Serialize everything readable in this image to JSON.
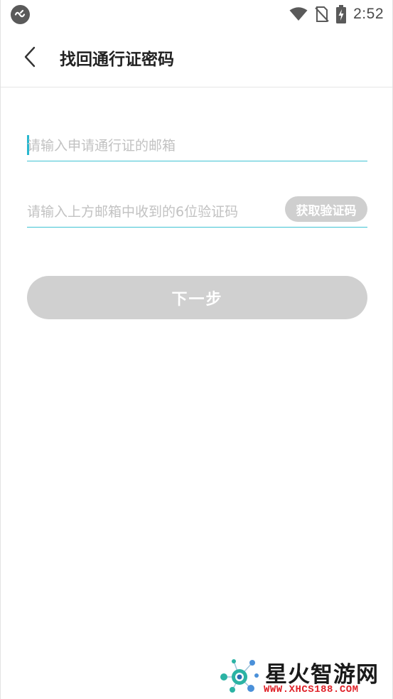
{
  "status_bar": {
    "time": "2:52",
    "icons": [
      "app-notification-icon",
      "wifi-icon",
      "no-sim-icon",
      "battery-charging-icon"
    ]
  },
  "header": {
    "title": "找回通行证密码",
    "back_icon": "chevron-left-icon"
  },
  "form": {
    "email": {
      "placeholder": "请输入申请通行证的邮箱",
      "value": ""
    },
    "code": {
      "placeholder": "请输入上方邮箱中收到的6位验证码",
      "value": ""
    },
    "get_code_label": "获取验证码",
    "next_label": "下一步"
  },
  "watermark": {
    "title": "星火智游网",
    "url": "WWW.XHCS188.COM"
  },
  "colors": {
    "accent": "#3fc3d4",
    "cursor": "#29b8cf",
    "disabled_button": "#d0d0d0",
    "watermark_url": "#e0242b"
  }
}
